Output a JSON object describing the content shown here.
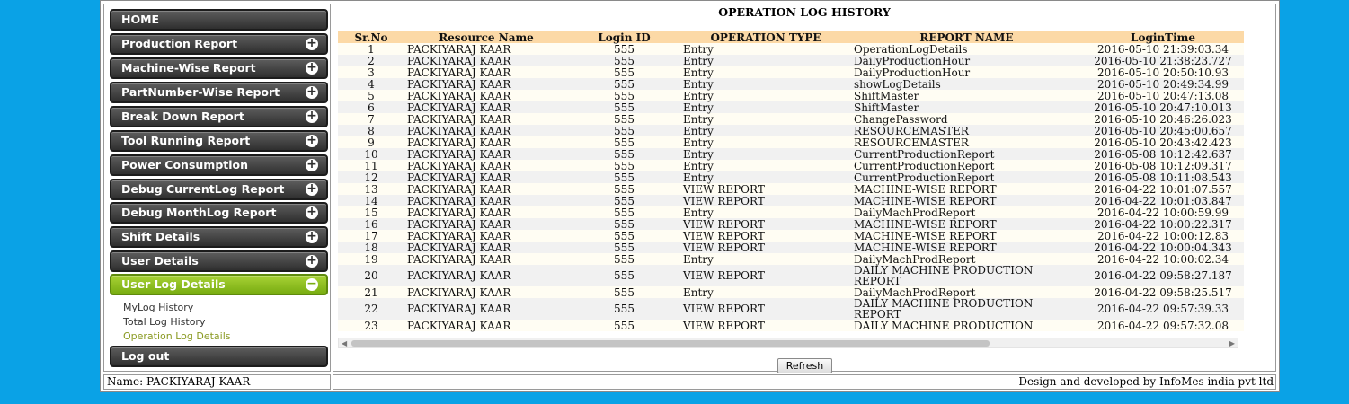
{
  "sidebar": {
    "items": [
      {
        "label": "HOME",
        "icon": ""
      },
      {
        "label": "Production Report",
        "icon": "plus-icon"
      },
      {
        "label": "Machine-Wise Report",
        "icon": "plus-icon"
      },
      {
        "label": "PartNumber-Wise Report",
        "icon": "plus-icon"
      },
      {
        "label": "Break Down Report",
        "icon": "plus-icon"
      },
      {
        "label": "Tool Running Report",
        "icon": "plus-icon"
      },
      {
        "label": "Power Consumption",
        "icon": "plus-icon"
      },
      {
        "label": "Debug CurrentLog Report",
        "icon": "plus-icon"
      },
      {
        "label": "Debug MonthLog Report",
        "icon": "plus-icon"
      },
      {
        "label": "Shift Details",
        "icon": "plus-icon"
      },
      {
        "label": "User Details",
        "icon": "plus-icon"
      },
      {
        "label": "User Log Details",
        "icon": "minus-icon"
      }
    ],
    "submenu": [
      "MyLog History",
      "Total Log History",
      "Operation Log Details"
    ],
    "logout": "Log out",
    "plus_glyph": "+",
    "minus_glyph": "−",
    "active_color": "#8bbf1f"
  },
  "main": {
    "title": "OPERATION LOG HISTORY",
    "columns": [
      "Sr.No",
      "Resource Name",
      "Login ID",
      "OPERATION TYPE",
      "REPORT NAME",
      "LoginTime"
    ],
    "rows": [
      [
        "1",
        "PACKIYARAJ KAAR",
        "555",
        "Entry",
        "OperationLogDetails",
        "2016-05-10 21:39:03.34"
      ],
      [
        "2",
        "PACKIYARAJ KAAR",
        "555",
        "Entry",
        "DailyProductionHour",
        "2016-05-10 21:38:23.727"
      ],
      [
        "3",
        "PACKIYARAJ KAAR",
        "555",
        "Entry",
        "DailyProductionHour",
        "2016-05-10 20:50:10.93"
      ],
      [
        "4",
        "PACKIYARAJ KAAR",
        "555",
        "Entry",
        "showLogDetails",
        "2016-05-10 20:49:34.99"
      ],
      [
        "5",
        "PACKIYARAJ KAAR",
        "555",
        "Entry",
        "ShiftMaster",
        "2016-05-10 20:47:13.08"
      ],
      [
        "6",
        "PACKIYARAJ KAAR",
        "555",
        "Entry",
        "ShiftMaster",
        "2016-05-10 20:47:10.013"
      ],
      [
        "7",
        "PACKIYARAJ KAAR",
        "555",
        "Entry",
        "ChangePassword",
        "2016-05-10 20:46:26.023"
      ],
      [
        "8",
        "PACKIYARAJ KAAR",
        "555",
        "Entry",
        "RESOURCEMASTER",
        "2016-05-10 20:45:00.657"
      ],
      [
        "9",
        "PACKIYARAJ KAAR",
        "555",
        "Entry",
        "RESOURCEMASTER",
        "2016-05-10 20:43:42.423"
      ],
      [
        "10",
        "PACKIYARAJ KAAR",
        "555",
        "Entry",
        "CurrentProductionReport",
        "2016-05-08 10:12:42.637"
      ],
      [
        "11",
        "PACKIYARAJ KAAR",
        "555",
        "Entry",
        "CurrentProductionReport",
        "2016-05-08 10:12:09.317"
      ],
      [
        "12",
        "PACKIYARAJ KAAR",
        "555",
        "Entry",
        "CurrentProductionReport",
        "2016-05-08 10:11:08.543"
      ],
      [
        "13",
        "PACKIYARAJ KAAR",
        "555",
        "VIEW REPORT",
        "MACHINE-WISE REPORT",
        "2016-04-22 10:01:07.557"
      ],
      [
        "14",
        "PACKIYARAJ KAAR",
        "555",
        "VIEW REPORT",
        "MACHINE-WISE REPORT",
        "2016-04-22 10:01:03.847"
      ],
      [
        "15",
        "PACKIYARAJ KAAR",
        "555",
        "Entry",
        "DailyMachProdReport",
        "2016-04-22 10:00:59.99"
      ],
      [
        "16",
        "PACKIYARAJ KAAR",
        "555",
        "VIEW REPORT",
        "MACHINE-WISE REPORT",
        "2016-04-22 10:00:22.317"
      ],
      [
        "17",
        "PACKIYARAJ KAAR",
        "555",
        "VIEW REPORT",
        "MACHINE-WISE REPORT",
        "2016-04-22 10:00:12.83"
      ],
      [
        "18",
        "PACKIYARAJ KAAR",
        "555",
        "VIEW REPORT",
        "MACHINE-WISE REPORT",
        "2016-04-22 10:00:04.343"
      ],
      [
        "19",
        "PACKIYARAJ KAAR",
        "555",
        "Entry",
        "DailyMachProdReport",
        "2016-04-22 10:00:02.34"
      ],
      [
        "20",
        "PACKIYARAJ KAAR",
        "555",
        "VIEW REPORT",
        "DAILY MACHINE PRODUCTION REPORT",
        "2016-04-22 09:58:27.187"
      ],
      [
        "21",
        "PACKIYARAJ KAAR",
        "555",
        "Entry",
        "DailyMachProdReport",
        "2016-04-22 09:58:25.517"
      ],
      [
        "22",
        "PACKIYARAJ KAAR",
        "555",
        "VIEW REPORT",
        "DAILY MACHINE PRODUCTION REPORT",
        "2016-04-22 09:57:39.33"
      ],
      [
        "23",
        "PACKIYARAJ KAAR",
        "555",
        "VIEW REPORT",
        "DAILY MACHINE PRODUCTION",
        "2016-04-22 09:57:32.08"
      ]
    ],
    "refresh_label": "Refresh"
  },
  "footer": {
    "user": "Name: PACKIYARAJ KAAR",
    "credit": "Design and developed by InfoMes india pvt ltd"
  }
}
